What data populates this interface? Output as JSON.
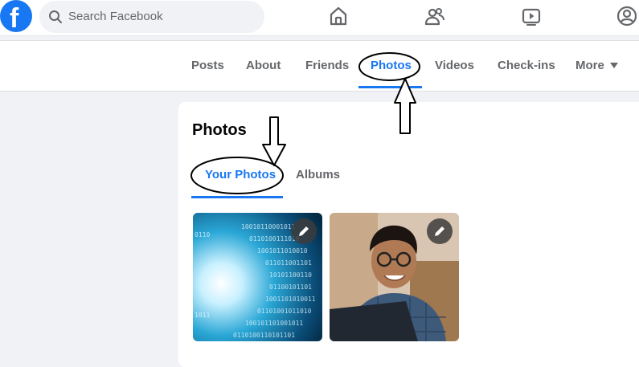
{
  "header": {
    "logo_letter": "f",
    "search": {
      "placeholder": "Search Facebook"
    },
    "nav_icons": [
      "home-icon",
      "friends-icon",
      "watch-icon",
      "profile-icon"
    ]
  },
  "profile_tabs": [
    {
      "label": "Posts"
    },
    {
      "label": "About"
    },
    {
      "label": "Friends"
    },
    {
      "label": "Photos",
      "active": true
    },
    {
      "label": "Videos"
    },
    {
      "label": "Check-ins"
    },
    {
      "label": "More"
    }
  ],
  "photos_section": {
    "title": "Photos",
    "subtabs": [
      {
        "label": "Your Photos",
        "active": true
      },
      {
        "label": "Albums"
      }
    ],
    "items": [
      {
        "subject": "blue binary digital tunnel"
      },
      {
        "subject": "smiling man with glasses at laptop"
      }
    ]
  },
  "colors": {
    "brand": "#1877f2",
    "background": "#f0f2f5",
    "muted_text": "#65676b"
  }
}
